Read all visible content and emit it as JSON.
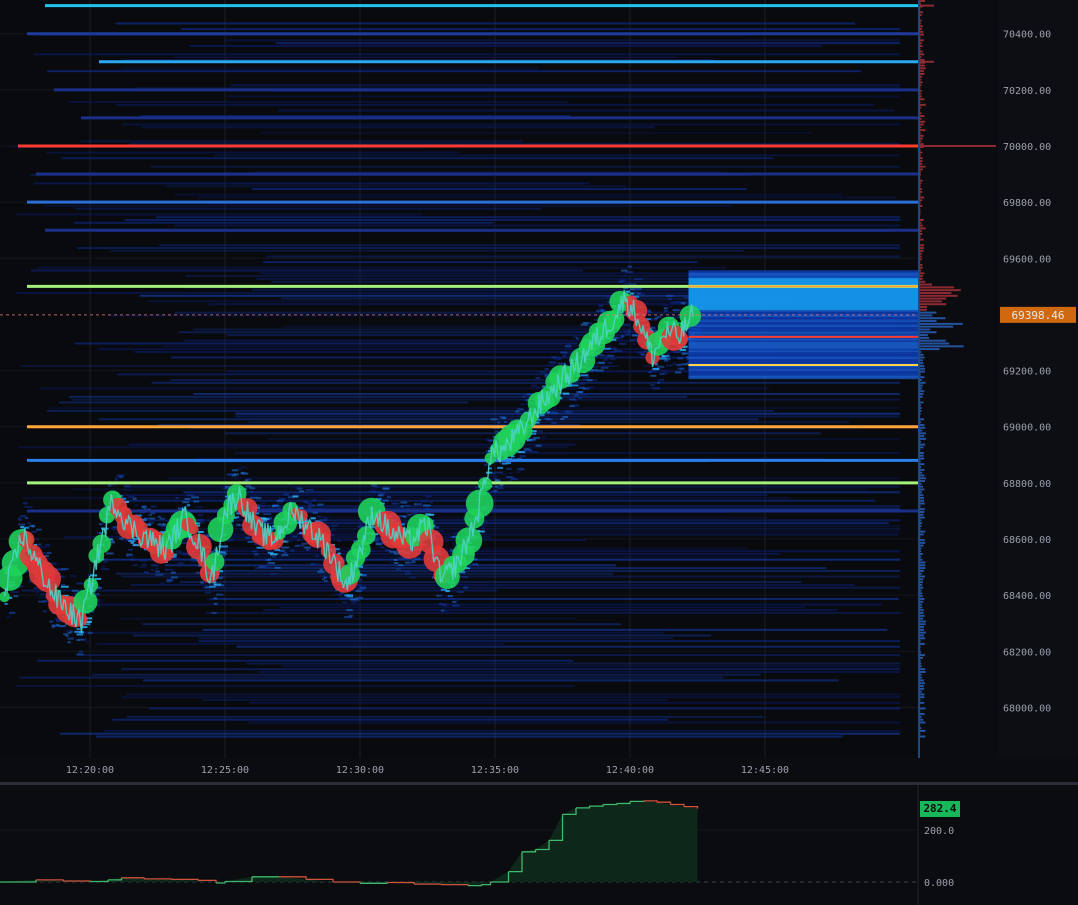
{
  "chart_data": [
    {
      "type": "heatmap",
      "title": "",
      "xlabel": "",
      "ylabel": "",
      "ylim": [
        67820,
        70520
      ],
      "xlim": [
        "12:16:40",
        "12:50:40"
      ],
      "grid": true,
      "x_ticks": [
        "12:20:00",
        "12:25:00",
        "12:30:00",
        "12:35:00",
        "12:40:00",
        "12:45:00"
      ],
      "y_ticks": [
        "70400.00",
        "70200.00",
        "70000.00",
        "69800.00",
        "69600.00",
        "69200.00",
        "69000.00",
        "68800.00",
        "68600.00",
        "68400.00",
        "68200.00",
        "68000.00"
      ],
      "current_price_label": "69398.46",
      "current_price": 69398.46,
      "levels": [
        {
          "price": 70500,
          "start": "12:18:20",
          "color": "#22c3ee"
        },
        {
          "price": 70400,
          "start": "12:17:40",
          "color": "#1e3a9a"
        },
        {
          "price": 70300,
          "start": "12:20:20",
          "color": "#2aa8f0"
        },
        {
          "price": 70200,
          "start": "12:18:40",
          "color": "#1a2f88"
        },
        {
          "price": 70100,
          "start": "12:19:40",
          "color": "#1a2f88"
        },
        {
          "price": 70000,
          "start": "12:17:20",
          "color": "#ff3b30"
        },
        {
          "price": 69900,
          "start": "12:18:00",
          "color": "#1a2f88"
        },
        {
          "price": 69800,
          "start": "12:17:40",
          "color": "#2a6fd8"
        },
        {
          "price": 69700,
          "start": "12:18:20",
          "color": "#1a2f88"
        },
        {
          "price": 69500,
          "start": "12:17:40",
          "color": "#a4f07a"
        },
        {
          "price": 69000,
          "start": "12:17:40",
          "color": "#ffa53a"
        },
        {
          "price": 68880,
          "start": "12:17:40",
          "color": "#2a7fe8"
        },
        {
          "price": 68800,
          "start": "12:17:40",
          "color": "#a4f07a"
        },
        {
          "price": 68700,
          "start": "12:17:40",
          "color": "#1a2f88"
        }
      ],
      "price_path": {
        "time": [
          "12:16:50",
          "12:17:30",
          "12:18:00",
          "12:18:40",
          "12:19:10",
          "12:19:40",
          "12:20:20",
          "12:20:50",
          "12:21:30",
          "12:22:10",
          "12:22:50",
          "12:23:30",
          "12:24:00",
          "12:24:30",
          "12:25:00",
          "12:25:30",
          "12:26:10",
          "12:26:50",
          "12:27:30",
          "12:28:10",
          "12:28:50",
          "12:29:30",
          "12:30:00",
          "12:30:30",
          "12:31:10",
          "12:31:50",
          "12:32:30",
          "12:33:00",
          "12:33:40",
          "12:34:20",
          "12:34:50",
          "12:35:20",
          "12:36:00",
          "12:36:40",
          "12:37:20",
          "12:38:00",
          "12:38:40",
          "12:39:20",
          "12:39:50",
          "12:40:20",
          "12:40:50",
          "12:41:20",
          "12:41:50",
          "12:42:20"
        ],
        "price": [
          68400,
          68620,
          68520,
          68400,
          68350,
          68300,
          68560,
          68740,
          68640,
          68600,
          68560,
          68680,
          68590,
          68450,
          68700,
          68760,
          68630,
          68600,
          68700,
          68640,
          68560,
          68430,
          68560,
          68700,
          68620,
          68590,
          68650,
          68450,
          68520,
          68680,
          68900,
          68920,
          68990,
          69080,
          69150,
          69220,
          69300,
          69380,
          69460,
          69380,
          69250,
          69340,
          69320,
          69400
        ],
        "buy_color": "#1fd05a",
        "sell_color": "#e03a3a",
        "line_color": "#4fd3c4"
      }
    },
    {
      "type": "line",
      "title": "",
      "xlabel": "",
      "ylabel": "",
      "ylim": [
        -15,
        330
      ],
      "y_ticks": [
        "200.0",
        "0.000"
      ],
      "last_value_label": "282.4",
      "last_value": 282.4,
      "x": [
        "12:16:40",
        "12:18:00",
        "12:19:00",
        "12:20:00",
        "12:20:40",
        "12:21:10",
        "12:22:00",
        "12:23:00",
        "12:24:00",
        "12:24:40",
        "12:25:00",
        "12:26:00",
        "12:27:00",
        "12:28:00",
        "12:29:00",
        "12:30:00",
        "12:31:00",
        "12:32:00",
        "12:33:00",
        "12:34:00",
        "12:34:30",
        "12:34:50",
        "12:35:30",
        "12:36:00",
        "12:36:30",
        "12:37:00",
        "12:37:30",
        "12:38:00",
        "12:38:30",
        "12:39:00",
        "12:39:30",
        "12:40:00",
        "12:40:30",
        "12:41:00",
        "12:41:30",
        "12:42:00",
        "12:42:30"
      ],
      "y": [
        0,
        8,
        4,
        2,
        8,
        16,
        12,
        10,
        6,
        -4,
        2,
        20,
        20,
        10,
        0,
        -5,
        -2,
        -8,
        -10,
        -14,
        -10,
        0,
        40,
        116,
        125,
        160,
        260,
        285,
        292,
        298,
        302,
        310,
        312,
        307,
        298,
        290,
        282.4
      ],
      "fill_color": "#0d2a1c",
      "up_color": "#3fb96b",
      "down_color": "#d0523a"
    }
  ]
}
